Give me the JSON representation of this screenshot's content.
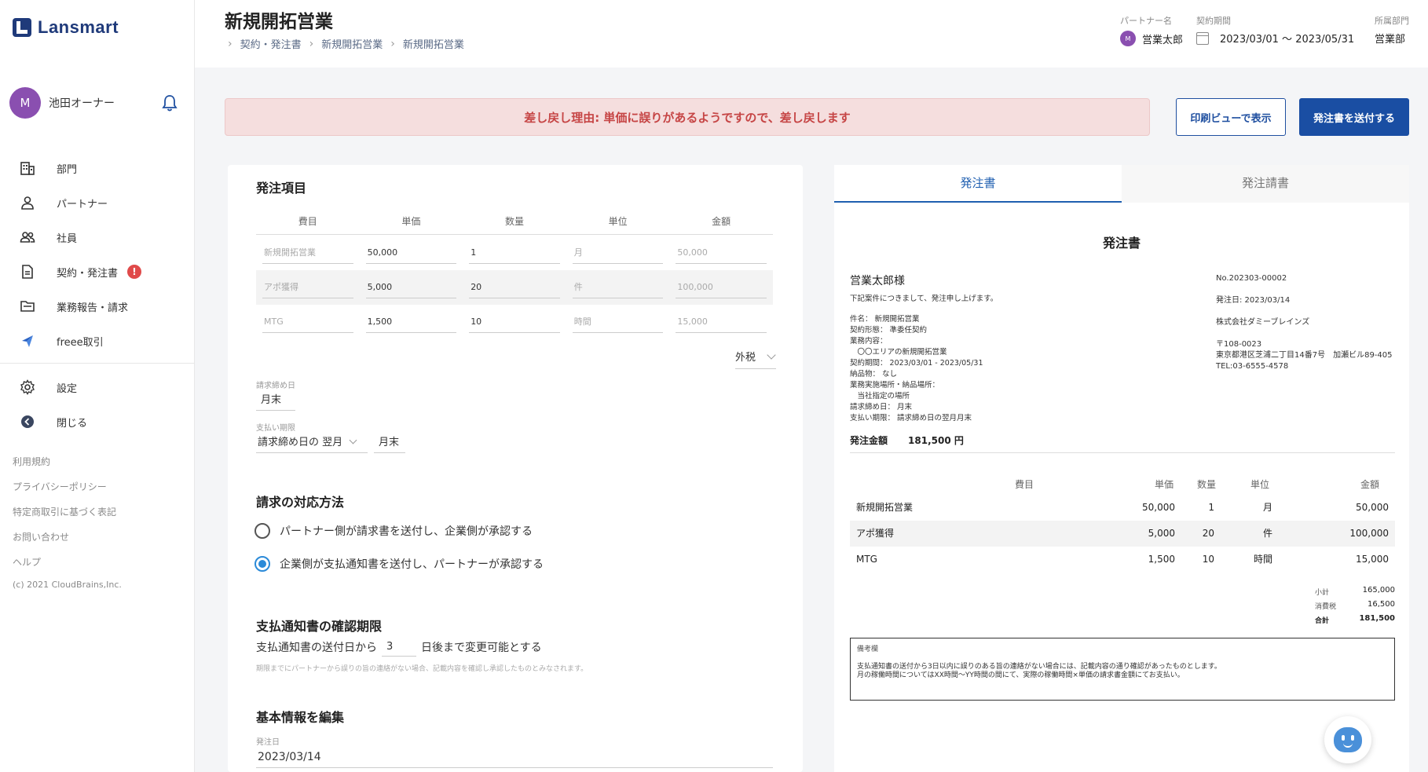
{
  "app": {
    "logo_text": "Lansmart"
  },
  "user": {
    "avatar_letter": "M",
    "name": "池田オーナー"
  },
  "nav": {
    "items": [
      {
        "label": "部門"
      },
      {
        "label": "パートナー"
      },
      {
        "label": "社員"
      },
      {
        "label": "契約・発注書"
      },
      {
        "label": "業務報告・請求"
      },
      {
        "label": "freee取引"
      }
    ],
    "contract_badge": "!",
    "settings": "設定",
    "close": "閉じる"
  },
  "footer": {
    "links": [
      "利用規約",
      "プライバシーポリシー",
      "特定商取引に基づく表記",
      "お問い合わせ",
      "ヘルプ"
    ],
    "copyright": "(c) 2021 CloudBrains,Inc."
  },
  "header": {
    "title": "新規開拓営業",
    "breadcrumbs": [
      "契約・発注書",
      "新規開拓営業",
      "新規開拓営業"
    ],
    "partner_label": "パートナー名",
    "partner_avatar": "M",
    "partner_name": "営業太郎",
    "period_label": "契約期間",
    "period_value": "2023/03/01 〜 2023/05/31",
    "dept_label": "所属部門",
    "dept_value": "営業部"
  },
  "alert": {
    "text": "差し戻し理由: 単価に誤りがあるようですので、差し戻します"
  },
  "actions": {
    "print_view": "印刷ビューで表示",
    "send_order": "発注書を送付する"
  },
  "form": {
    "items_title": "発注項目",
    "columns": [
      "費目",
      "単価",
      "数量",
      "単位",
      "金額"
    ],
    "rows": [
      {
        "name": "新規開拓営業",
        "unit_price": "50,000",
        "qty": "1",
        "unit": "月",
        "amount": "50,000"
      },
      {
        "name": "アポ獲得",
        "unit_price": "5,000",
        "qty": "20",
        "unit": "件",
        "amount": "100,000"
      },
      {
        "name": "MTG",
        "unit_price": "1,500",
        "qty": "10",
        "unit": "時間",
        "amount": "15,000"
      }
    ],
    "tax": "外税",
    "closing_label": "請求締め日",
    "closing_value": "月末",
    "payment_label": "支払い期限",
    "payment_select": "請求締め日の 翌月",
    "payment_day": "月末",
    "billing_title": "請求の対応方法",
    "billing_option_1": "パートナー側が請求書を送付し、企業側が承認する",
    "billing_option_2": "企業側が支払通知書を送付し、パートナーが承認する",
    "deadline_title": "支払通知書の確認期限",
    "deadline_prefix": "支払通知書の送付日から",
    "deadline_days": "3",
    "deadline_suffix": "日後まで変更可能とする",
    "deadline_note": "期限までにパートナーから誤りの旨の連絡がない場合、記載内容を確認し承認したものとみなされます。",
    "basic_title": "基本情報を編集",
    "order_date_label": "発注日",
    "order_date": "2023/03/14"
  },
  "preview": {
    "tab_order": "発注書",
    "tab_request": "発注請書",
    "doc_title": "発注書",
    "to": "営業太郎様",
    "intro": "下記案件につきまして、発注申し上げます。",
    "details": [
      "件名： 新規開拓営業",
      "契約形態： 準委任契約",
      "業務内容：",
      "　〇〇エリアの新規開拓営業",
      "契約期間： 2023/03/01 - 2023/05/31",
      "納品物： なし",
      "業務実施場所・納品場所：",
      "　当社指定の場所",
      "請求締め日： 月末",
      "支払い期限： 請求締め日の翌月月末"
    ],
    "doc_no": "No.202303-00002",
    "issue_date": "発注日: 2023/03/14",
    "company": "株式会社ダミーブレインズ",
    "postal": "〒108-0023",
    "address": "東京都港区芝浦二丁目14番7号　加瀬ビル89-405",
    "tel": "TEL:03-6555-4578",
    "amount_label": "発注金額",
    "amount_value": "181,500 円",
    "table_head": [
      "費目",
      "単価",
      "数量",
      "単位",
      "金額"
    ],
    "table_rows": [
      {
        "name": "新規開拓営業",
        "unit_price": "50,000",
        "qty": "1",
        "unit": "月",
        "amount": "50,000"
      },
      {
        "name": "アポ獲得",
        "unit_price": "5,000",
        "qty": "20",
        "unit": "件",
        "amount": "100,000"
      },
      {
        "name": "MTG",
        "unit_price": "1,500",
        "qty": "10",
        "unit": "時間",
        "amount": "15,000"
      }
    ],
    "subtotal_label": "小計",
    "subtotal": "165,000",
    "tax_label": "消費税",
    "tax": "16,500",
    "total_label": "合計",
    "total": "181,500",
    "remarks_label": "備考欄",
    "remarks_line_1": "支払通知書の送付から3日以内に誤りのある旨の連絡がない場合には、記載内容の通り確認があったものとします。",
    "remarks_line_2": "月の稼働時間についてはXX時間〜YY時間の間にて、実際の稼働時間×単価の請求書金額にてお支払い。"
  },
  "colors": {
    "brand": "#1f3a7a",
    "primary": "#1a4ea3",
    "alert_bg": "#f5dede",
    "alert_text": "#c64545",
    "radio_on": "#2b8ad8"
  }
}
